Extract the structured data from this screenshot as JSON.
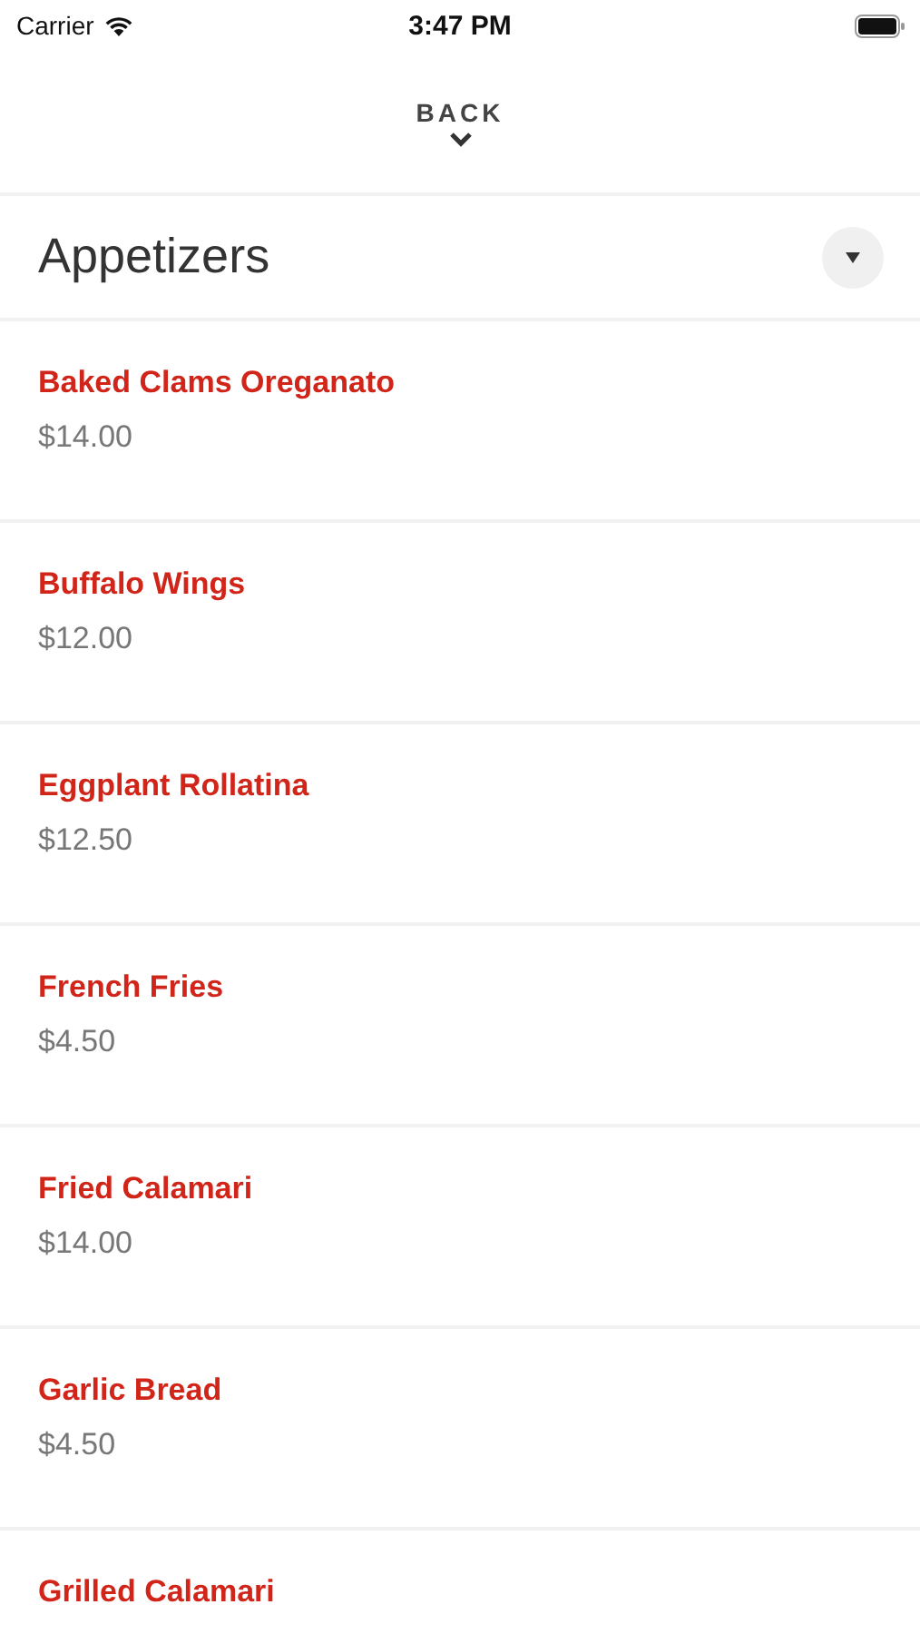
{
  "status_bar": {
    "carrier": "Carrier",
    "time": "3:47 PM"
  },
  "back": {
    "label": "BACK"
  },
  "section": {
    "title": "Appetizers"
  },
  "items": [
    {
      "name": "Baked Clams Oreganato",
      "price": "$14.00"
    },
    {
      "name": "Buffalo Wings",
      "price": "$12.00"
    },
    {
      "name": "Eggplant Rollatina",
      "price": "$12.50"
    },
    {
      "name": "French Fries",
      "price": "$4.50"
    },
    {
      "name": "Fried Calamari",
      "price": "$14.00"
    },
    {
      "name": "Garlic Bread",
      "price": "$4.50"
    },
    {
      "name": "Grilled Calamari"
    }
  ]
}
